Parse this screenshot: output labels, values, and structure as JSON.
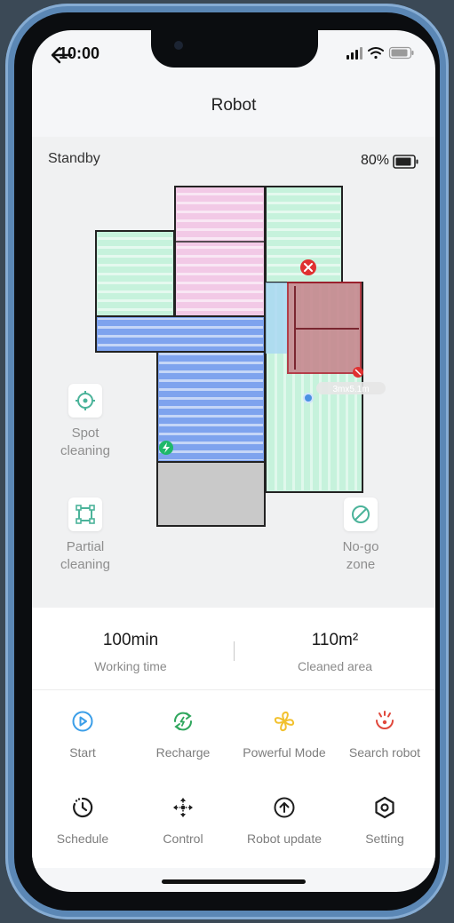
{
  "status_bar": {
    "time": "10:00"
  },
  "header": {
    "title": "Robot"
  },
  "robot": {
    "state": "Standby",
    "battery": "80%"
  },
  "map": {
    "room_dimension": "3mx5.1m",
    "colors": {
      "pink": "#f2c9e6",
      "green": "#c6f2dc",
      "blue": "#7ea3ee",
      "gray": "#c9c9c9",
      "nogo": "#c6828a"
    }
  },
  "tools": {
    "spot": {
      "line1": "Spot",
      "line2": "cleaning"
    },
    "partial": {
      "line1": "Partial",
      "line2": "cleaning"
    },
    "nogo": {
      "line1": "No-go",
      "line2": "zone"
    }
  },
  "stats": {
    "working_time": {
      "value": "100min",
      "label": "Working time"
    },
    "cleaned_area": {
      "value": "110m²",
      "label": "Cleaned area"
    }
  },
  "actions": {
    "start": "Start",
    "recharge": "Recharge",
    "powerful": "Powerful Mode",
    "search": "Search robot",
    "schedule": "Schedule",
    "control": "Control",
    "update": "Robot update",
    "setting": "Setting"
  },
  "icon_colors": {
    "start": "#3b9ee8",
    "recharge": "#2fa65d",
    "powerful": "#f2c12e",
    "search": "#e0483c",
    "dark": "#1e1e1e",
    "tool": "#4bb39a"
  }
}
